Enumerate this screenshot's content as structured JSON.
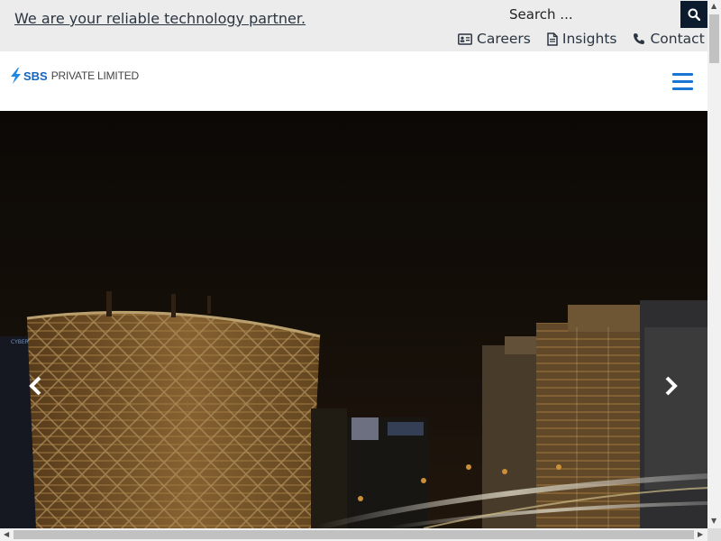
{
  "topbar": {
    "tagline": "We are your reliable technology partner.",
    "search": {
      "placeholder": "Search ...",
      "button_icon": "search-icon"
    },
    "links": [
      {
        "label": "Careers",
        "icon": "id-card-icon"
      },
      {
        "label": "Insights",
        "icon": "file-icon"
      },
      {
        "label": "Contact",
        "icon": "phone-icon"
      }
    ]
  },
  "header": {
    "logo": {
      "brand": "SBS",
      "suffix": "PRIVATE LIMITED"
    },
    "menu_icon": "hamburger-icon"
  },
  "hero": {
    "image_description_icon": "city-night-skyline",
    "building_sign": "CYBER TO",
    "prev_icon": "chevron-left-icon",
    "next_icon": "chevron-right-icon"
  },
  "colors": {
    "accent": "#1976d2",
    "topbar_bg": "#ececed",
    "search_button_bg": "#0d1b2e",
    "text": "#2b3540"
  }
}
